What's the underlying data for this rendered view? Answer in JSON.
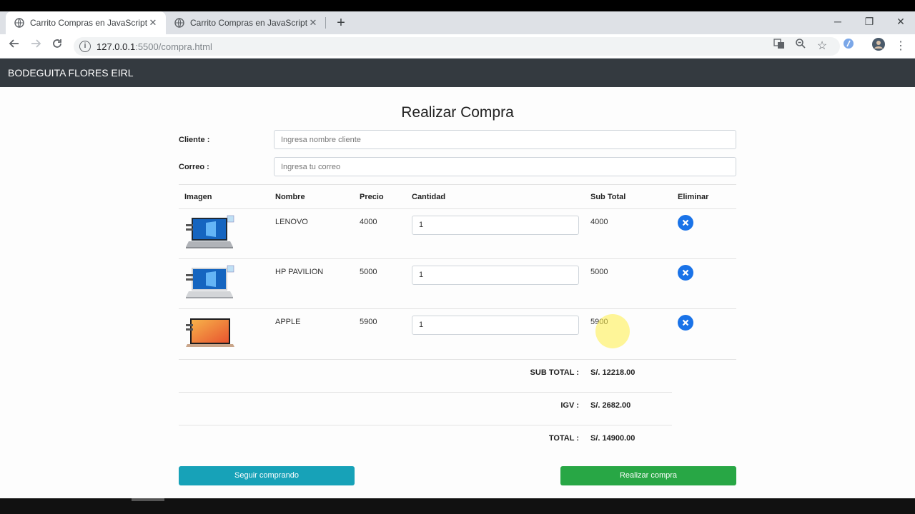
{
  "browser": {
    "tabs": [
      {
        "title": "Carrito Compras en JavaScript",
        "active": true
      },
      {
        "title": "Carrito Compras en JavaScript",
        "active": false
      }
    ],
    "url_host": "127.0.0.1",
    "url_path": ":5500/compra.html"
  },
  "navbar": {
    "brand": "BODEGUITA FLORES EIRL"
  },
  "page": {
    "title": "Realizar Compra"
  },
  "form": {
    "cliente_label": "Cliente :",
    "cliente_placeholder": "Ingresa nombre cliente",
    "correo_label": "Correo :",
    "correo_placeholder": "Ingresa tu correo"
  },
  "table": {
    "headers": [
      "Imagen",
      "Nombre",
      "Precio",
      "Cantidad",
      "Sub Total",
      "Eliminar"
    ],
    "rows": [
      {
        "nombre": "LENOVO",
        "precio": "4000",
        "cantidad": "1",
        "subtotal": "4000"
      },
      {
        "nombre": "HP PAVILION",
        "precio": "5000",
        "cantidad": "1",
        "subtotal": "5000"
      },
      {
        "nombre": "APPLE",
        "precio": "5900",
        "cantidad": "1",
        "subtotal": "5900"
      }
    ]
  },
  "totals": {
    "subtotal_label": "SUB TOTAL :",
    "subtotal_value": "S/. 12218.00",
    "igv_label": "IGV :",
    "igv_value": "S/. 2682.00",
    "total_label": "TOTAL :",
    "total_value": "S/. 14900.00"
  },
  "buttons": {
    "seguir": "Seguir comprando",
    "realizar": "Realizar compra"
  },
  "colors": {
    "navbar": "#343a40",
    "info": "#17a2b8",
    "success": "#28a745",
    "delete": "#1a73e8"
  }
}
